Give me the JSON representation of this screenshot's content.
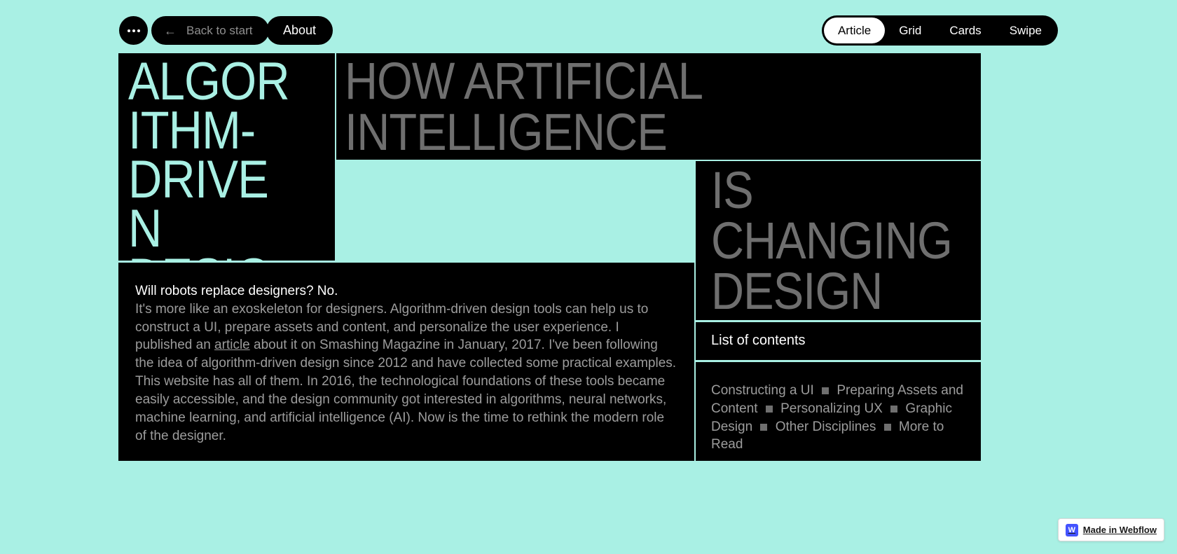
{
  "nav": {
    "back_label": "Back to start",
    "about_label": "About",
    "tabs": [
      "Article",
      "Grid",
      "Cards",
      "Swipe"
    ],
    "active_tab": 0
  },
  "hero": {
    "title": "ALGORITHM-DRIVEN DESIGN",
    "sub1": "HOW ARTIFICIAL INTELLIGENCE",
    "sub2": "IS CHANGING DESIGN"
  },
  "body": {
    "lead": "Will robots replace designers? No.",
    "text_before_link": "It's more like an exoskeleton for designers. Algorithm-driven design tools can help us to construct a UI, prepare assets and content, and personalize the user experience. I published an ",
    "link_text": "article",
    "text_after_link": " about it on Smashing Magazine in January, 2017. I've been following the idea of algorithm-driven design since 2012 and have collected some practical examples. This website has all of them. In 2016, the technological foundations of these tools became easily accessible, and the design community got interested in algorithms, neural networks, machine learning, and artificial intelligence (AI). Now is the time to rethink the modern role of the designer."
  },
  "toc": {
    "heading": "List of contents",
    "items": [
      "Constructing a UI",
      "Preparing Assets and Content ",
      "Personalizing UX",
      "Graphic Design",
      "Other Disciplines",
      "More to Read"
    ]
  },
  "badge": {
    "label": "Made in Webflow"
  }
}
